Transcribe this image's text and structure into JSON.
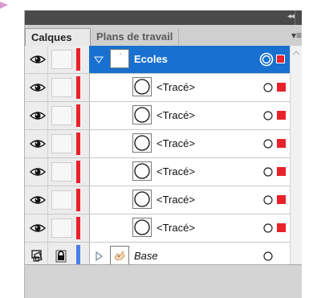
{
  "tabs": {
    "active": "Calques",
    "inactive": "Plans de travail"
  },
  "topbar": {
    "collapse_glyph": "◂◂",
    "close_glyph": "x"
  },
  "layers": [
    {
      "name": "Ecoles",
      "selected": true,
      "expanded": true,
      "level": 0,
      "color": "#e8222b"
    },
    {
      "name": "<Tracé>",
      "level": 1,
      "color": "#e8222b"
    },
    {
      "name": "<Tracé>",
      "level": 1,
      "color": "#e8222b"
    },
    {
      "name": "<Tracé>",
      "level": 1,
      "color": "#e8222b"
    },
    {
      "name": "<Tracé>",
      "level": 1,
      "color": "#e8222b"
    },
    {
      "name": "<Tracé>",
      "level": 1,
      "color": "#e8222b"
    },
    {
      "name": "<Tracé>",
      "level": 1,
      "color": "#e8222b"
    },
    {
      "name": "Base",
      "level": 0,
      "expanded": false,
      "locked": true,
      "color": "#4a7ee8",
      "italic": true
    }
  ],
  "icons": {
    "visibility": "eye-icon",
    "template": "template-icon",
    "lock": "lock-icon",
    "expand": "disclosure-triangle-icon",
    "target": "target-circle-icon",
    "panel_menu": "panel-menu-icon"
  },
  "colors": {
    "selection": "#1871d0",
    "layer_red": "#e8222b",
    "layer_blue": "#4a7ee8"
  }
}
